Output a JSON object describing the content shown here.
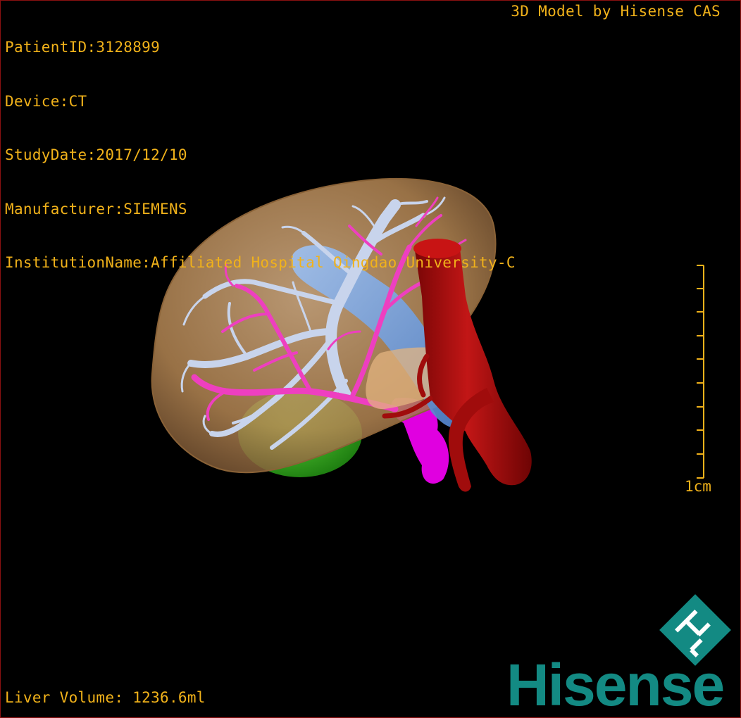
{
  "viewer": {
    "patient_id": "PatientID:3128899",
    "device": "Device:CT",
    "study_date": "StudyDate:2017/12/10",
    "manufacturer": "Manufacturer:SIEMENS",
    "institution": "InstitutionName:Affiliated Hospital Qingdao University-C",
    "credit": "3D Model by Hisense CAS",
    "volume": "Liver Volume: 1236.6ml",
    "scale_label": "1cm"
  },
  "brand": {
    "name": "Hisense",
    "mark": "HL",
    "color": "#138a83"
  },
  "colors": {
    "text": "#f1b21a",
    "liver": "#c89a66",
    "portal_vein": "#c8d4ec",
    "hepatic_artery": "#ee3fc0",
    "ivc": "#6e9ee0",
    "aorta": "#b00d0d",
    "gallbladder": "#3fb51f",
    "pancreas_magenta": "#e000e0"
  },
  "icons": [
    "scale-bar-icon",
    "hisense-logo-icon"
  ]
}
